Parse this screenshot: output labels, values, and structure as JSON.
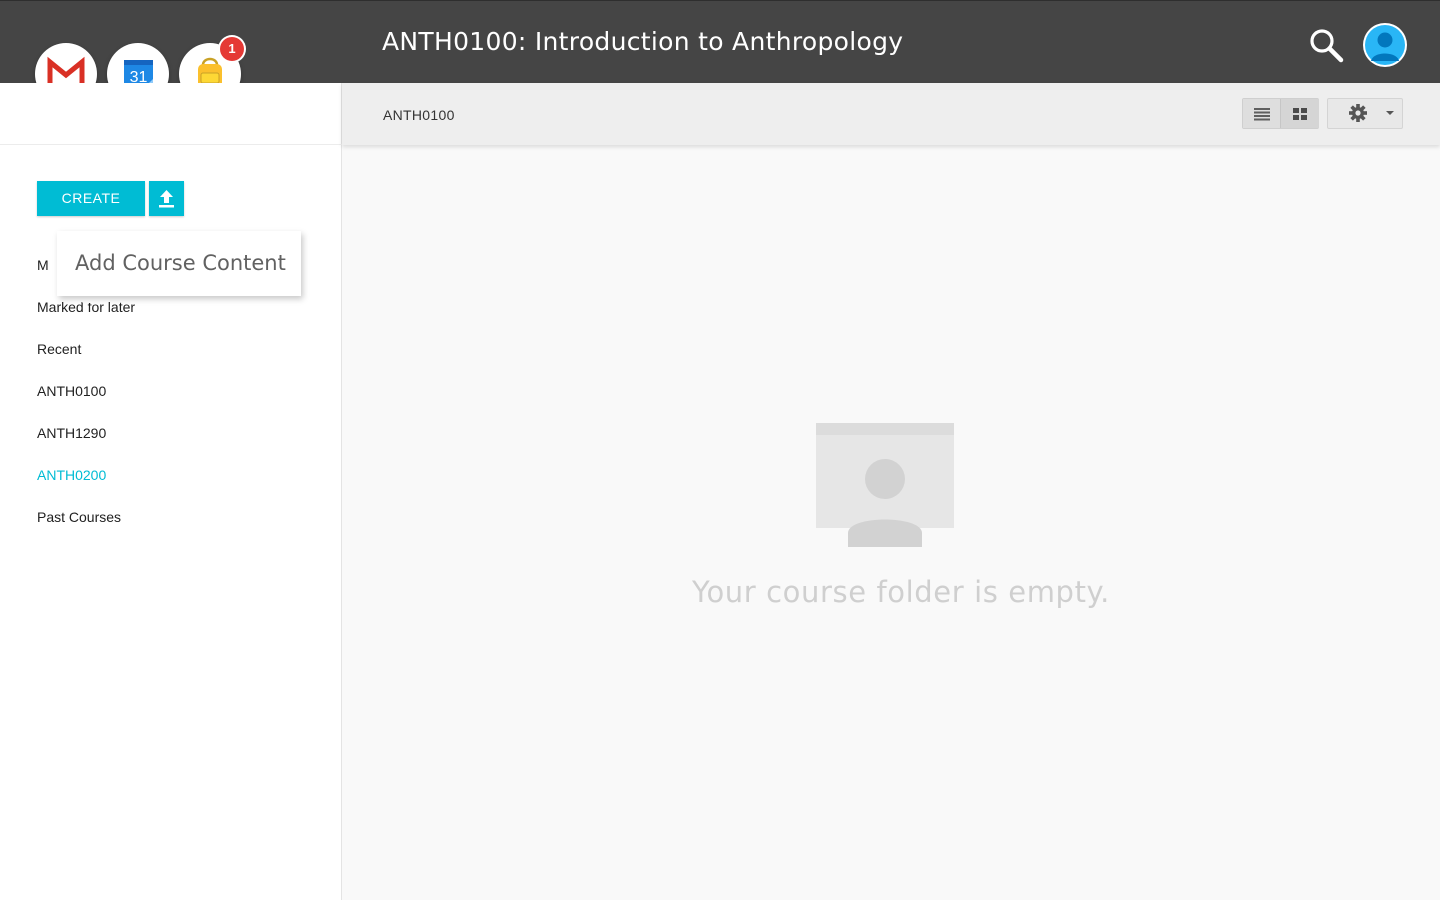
{
  "header": {
    "title": "ANTH0100: Introduction to Anthropology",
    "search_icon": "search-icon",
    "avatar_icon": "user-avatar-icon",
    "background": "#454545"
  },
  "apps": [
    {
      "name": "Gmail",
      "icon": "gmail-icon"
    },
    {
      "name": "Calendar",
      "icon": "calendar-icon",
      "text": "31"
    },
    {
      "name": "Backpack",
      "icon": "backpack-icon",
      "badge": "1"
    }
  ],
  "sidebar": {
    "create_label": "CREATE",
    "upload_icon": "upload-icon",
    "tooltip": "Add Course Content",
    "items": [
      {
        "label": "M",
        "active": false
      },
      {
        "label": "Marked for later",
        "active": false
      },
      {
        "label": "Recent",
        "active": false
      },
      {
        "label": "ANTH0100",
        "active": false
      },
      {
        "label": "ANTH1290",
        "active": false
      },
      {
        "label": "ANTH0200",
        "active": true
      },
      {
        "label": "Past Courses",
        "active": false
      }
    ]
  },
  "main": {
    "breadcrumb": "ANTH0100",
    "view_list_icon": "list-view-icon",
    "view_grid_icon": "grid-view-icon",
    "settings_icon": "gear-icon",
    "empty_message": "Your course folder is empty."
  },
  "colors": {
    "accent": "#00bcd4",
    "badge": "#e53935"
  }
}
